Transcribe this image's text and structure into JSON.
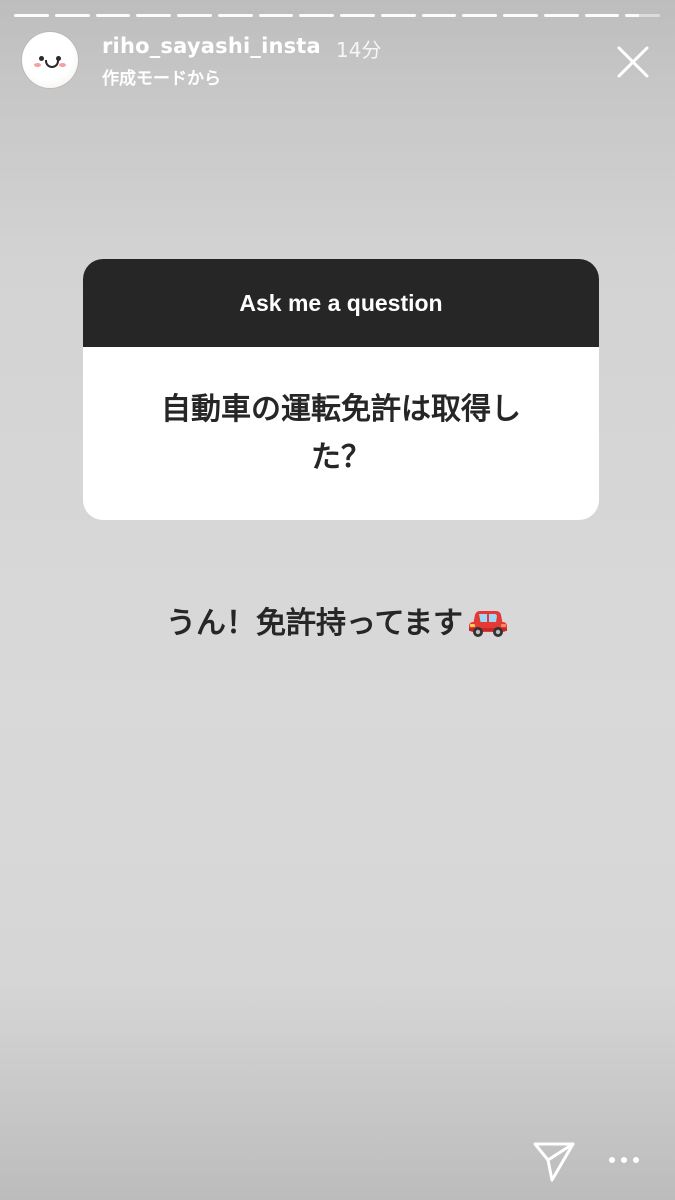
{
  "story": {
    "segment_count": 16,
    "current_segment_index": 15
  },
  "header": {
    "username": "riho_sayashi_insta",
    "time_ago": "14分",
    "subtitle": "作成モードから",
    "avatar_icon": "smiley-mochi-avatar",
    "close_icon": "close-icon"
  },
  "question_sticker": {
    "title": "Ask me a question",
    "question": "自動車の運転免許は取得した？"
  },
  "answer": {
    "text": "うん！免許持ってます",
    "emoji_icon": "red-car-icon"
  },
  "footer": {
    "send_icon": "send-icon",
    "more_icon": "more-options-icon"
  },
  "colors": {
    "sticker_header_bg": "#262626",
    "sticker_body_bg": "#ffffff",
    "text_dark": "#262626",
    "text_light": "#ffffff"
  }
}
